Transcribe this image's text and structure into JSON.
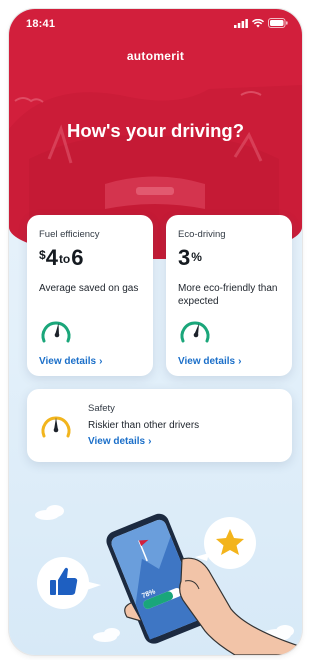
{
  "status_bar": {
    "time": "18:41",
    "icons": [
      "signal-icon",
      "wifi-icon",
      "battery-icon"
    ]
  },
  "app": {
    "name": "automerit"
  },
  "hero": {
    "title": "How's your driving?"
  },
  "cards": {
    "fuel": {
      "title": "Fuel efficiency",
      "currency": "$",
      "min": "4",
      "sep": "to",
      "max": "6",
      "desc": "Average saved on gas",
      "link": "View details",
      "gauge_color": "#1aa67a"
    },
    "eco": {
      "title": "Eco-driving",
      "value": "3",
      "unit": "%",
      "desc": "More eco-friendly than expected",
      "link": "View details",
      "gauge_color": "#1aa67a"
    },
    "safety": {
      "title": "Safety",
      "desc": "Riskier than other drivers",
      "link": "View details",
      "gauge_color": "#f2b51d"
    }
  },
  "illustration": {
    "phone_progress_label": "78%",
    "phone_progress": 0.78,
    "icons": [
      "thumbs-up-icon",
      "star-icon",
      "flag-icon"
    ]
  },
  "colors": {
    "brand_red": "#d21f3c",
    "link_blue": "#1b6fc9",
    "thumbs_blue": "#1e5fc1",
    "star_yellow": "#f3b41b"
  }
}
